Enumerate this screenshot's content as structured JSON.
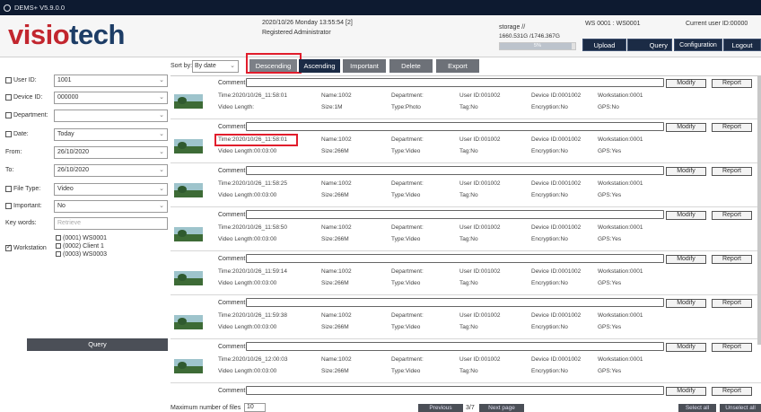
{
  "app_title": "DEMS+ V5.9.0.0",
  "logo": {
    "part1": "visio",
    "part2": "tech"
  },
  "header": {
    "datetime": "2020/10/26 Monday 13:55:54 [2]",
    "role": "Registered Administrator",
    "storage_label": "storage //",
    "storage_value": "1660.531G /1746.367G",
    "storage_percent_text": "5%",
    "storage_fraction": 0.95,
    "workstation": "WS 0001 : WS0001",
    "current_user": "Current user ID:00000"
  },
  "nav": {
    "upload": "Upload",
    "query": "Query",
    "configuration": "Configuration",
    "logout": "Logout"
  },
  "toolbar": {
    "sort_label": "Sort by:",
    "sort_value": "By date",
    "descending": "Descending",
    "ascending": "Ascending",
    "important": "Important",
    "delete": "Delete",
    "export": "Export"
  },
  "filters": {
    "user_id": {
      "label": "User ID:",
      "value": "1001"
    },
    "device_id": {
      "label": "Device ID:",
      "value": "000000"
    },
    "department": {
      "label": "Department:",
      "value": ""
    },
    "date": {
      "label": "Date:",
      "value": "Today"
    },
    "from": {
      "label": "From:",
      "value": "26/10/2020"
    },
    "to": {
      "label": "To:",
      "value": "26/10/2020"
    },
    "file_type": {
      "label": "File Type:",
      "value": "Video"
    },
    "important": {
      "label": "Important:",
      "value": "No"
    },
    "keywords": {
      "label": "Key words:",
      "placeholder": "Retrieve"
    },
    "workstation": {
      "label": "Workstation",
      "items": [
        "(0001) WS0001",
        "(0002) Client 1",
        "(0003) WS0003"
      ]
    },
    "query_button": "Query"
  },
  "record_labels": {
    "comment": "Comment:",
    "modify": "Modify",
    "report": "Report"
  },
  "records": [
    {
      "time": "Time:2020/10/26_11:58:01",
      "name": "Name:1002",
      "dept": "Department:",
      "user": "User ID:001002",
      "device": "Device ID:0001002",
      "ws": "Workstation:0001",
      "length": "Video Length:",
      "size": "Size:1M",
      "type": "Type:Photo",
      "tag": "Tag:No",
      "enc": "Encryption:No",
      "gps": "GPS:No"
    },
    {
      "time": "Time:2020/10/26_11:58:01",
      "name": "Name:1002",
      "dept": "Department:",
      "user": "User ID:001002",
      "device": "Device ID:0001002",
      "ws": "Workstation:0001",
      "length": "Video Length:00:03:00",
      "size": "Size:266M",
      "type": "Type:Video",
      "tag": "Tag:No",
      "enc": "Encryption:No",
      "gps": "GPS:Yes"
    },
    {
      "time": "Time:2020/10/26_11:58:25",
      "name": "Name:1002",
      "dept": "Department:",
      "user": "User ID:001002",
      "device": "Device ID:0001002",
      "ws": "Workstation:0001",
      "length": "Video Length:00:03:00",
      "size": "Size:266M",
      "type": "Type:Video",
      "tag": "Tag:No",
      "enc": "Encryption:No",
      "gps": "GPS:Yes"
    },
    {
      "time": "Time:2020/10/26_11:58:50",
      "name": "Name:1002",
      "dept": "Department:",
      "user": "User ID:001002",
      "device": "Device ID:0001002",
      "ws": "Workstation:0001",
      "length": "Video Length:00:03:00",
      "size": "Size:266M",
      "type": "Type:Video",
      "tag": "Tag:No",
      "enc": "Encryption:No",
      "gps": "GPS:Yes"
    },
    {
      "time": "Time:2020/10/26_11:59:14",
      "name": "Name:1002",
      "dept": "Department:",
      "user": "User ID:001002",
      "device": "Device ID:0001002",
      "ws": "Workstation:0001",
      "length": "Video Length:00:03:00",
      "size": "Size:266M",
      "type": "Type:Video",
      "tag": "Tag:No",
      "enc": "Encryption:No",
      "gps": "GPS:Yes"
    },
    {
      "time": "Time:2020/10/26_11:59:38",
      "name": "Name:1002",
      "dept": "Department:",
      "user": "User ID:001002",
      "device": "Device ID:0001002",
      "ws": "Workstation:0001",
      "length": "Video Length:00:03:00",
      "size": "Size:266M",
      "type": "Type:Video",
      "tag": "Tag:No",
      "enc": "Encryption:No",
      "gps": "GPS:Yes"
    },
    {
      "time": "Time:2020/10/26_12:00:03",
      "name": "Name:1002",
      "dept": "Department:",
      "user": "User ID:001002",
      "device": "Device ID:0001002",
      "ws": "Workstation:0001",
      "length": "Video Length:00:03:00",
      "size": "Size:266M",
      "type": "Type:Video",
      "tag": "Tag:No",
      "enc": "Encryption:No",
      "gps": "GPS:Yes"
    }
  ],
  "footer": {
    "max_files_label": "Maximum number of files",
    "max_files_value": "10",
    "previous": "Previous",
    "page": "3/7",
    "next": "Next page",
    "select_all": "Select all",
    "unselect_all": "Unselect all"
  },
  "colors": {
    "logo_red": "#c2262e",
    "logo_blue": "#1d3d66",
    "highlight": "#e11d2c",
    "nav_bg": "#1b2b45"
  }
}
